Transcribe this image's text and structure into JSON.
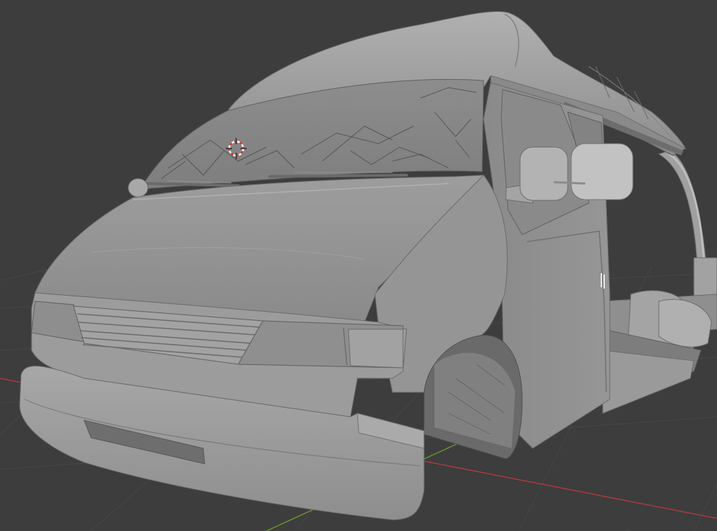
{
  "viewport": {
    "mode": "solid-shading",
    "background_color": "#3d3d3d",
    "grid_color": "#4a4a4a",
    "x_axis_color": "#c0393e",
    "y_axis_color": "#6b9a2e"
  },
  "object": {
    "kind": "van-model",
    "base_color": "#9a9a9a",
    "shadow_color": "#6f6f6f",
    "highlight_color": "#b3b3b3"
  },
  "cursor": {
    "name": "3d-cursor",
    "ring_color": "#d9392b",
    "ring_alt_color": "#ffffff"
  }
}
